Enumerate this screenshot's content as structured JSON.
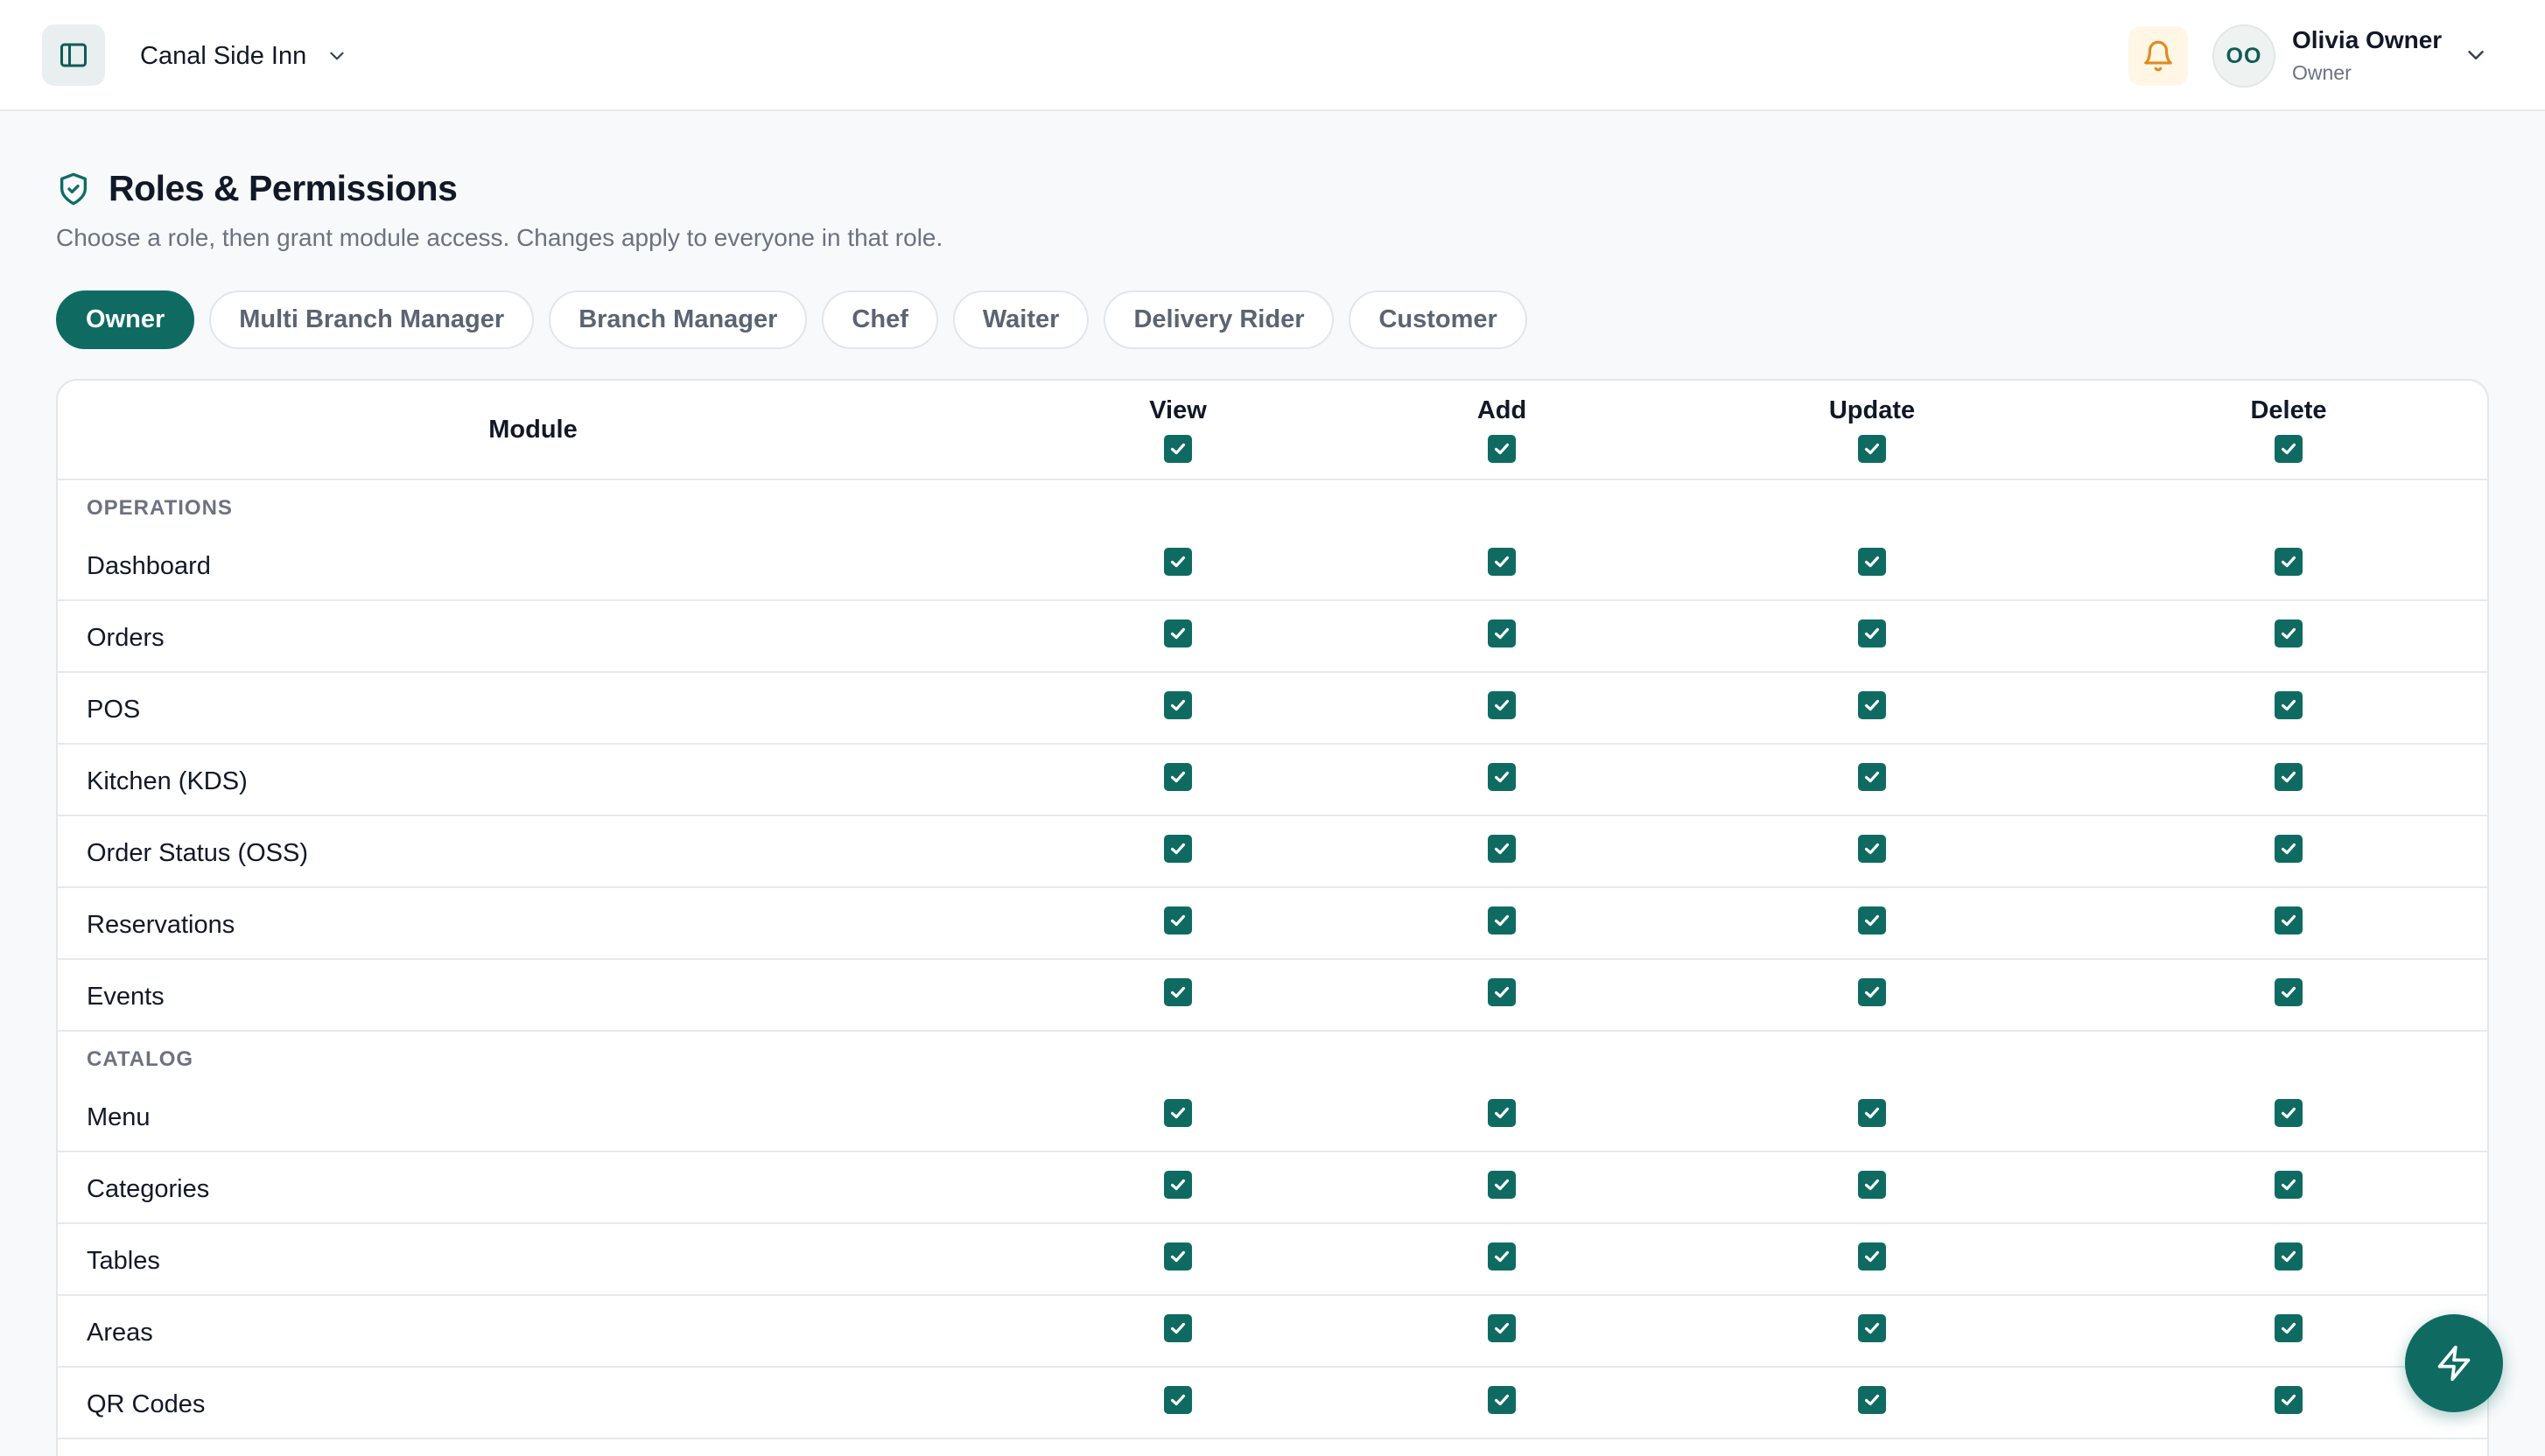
{
  "header": {
    "branch_name": "Canal Side Inn",
    "user_initials": "OO",
    "user_name": "Olivia Owner",
    "user_role": "Owner"
  },
  "page": {
    "title": "Roles & Permissions",
    "subtitle": "Choose a role, then grant module access. Changes apply to everyone in that role."
  },
  "roles": [
    "Owner",
    "Multi Branch Manager",
    "Branch Manager",
    "Chef",
    "Waiter",
    "Delivery Rider",
    "Customer"
  ],
  "active_role": "Owner",
  "table": {
    "columns": {
      "module": "Module",
      "view": "View",
      "add": "Add",
      "update": "Update",
      "delete": "Delete"
    },
    "sections": [
      {
        "label": "OPERATIONS",
        "rows": [
          {
            "module": "Dashboard",
            "view": true,
            "add": true,
            "update": true,
            "delete": true
          },
          {
            "module": "Orders",
            "view": true,
            "add": true,
            "update": true,
            "delete": true
          },
          {
            "module": "POS",
            "view": true,
            "add": true,
            "update": true,
            "delete": true
          },
          {
            "module": "Kitchen (KDS)",
            "view": true,
            "add": true,
            "update": true,
            "delete": true
          },
          {
            "module": "Order Status (OSS)",
            "view": true,
            "add": true,
            "update": true,
            "delete": true
          },
          {
            "module": "Reservations",
            "view": true,
            "add": true,
            "update": true,
            "delete": true
          },
          {
            "module": "Events",
            "view": true,
            "add": true,
            "update": true,
            "delete": true
          }
        ]
      },
      {
        "label": "CATALOG",
        "rows": [
          {
            "module": "Menu",
            "view": true,
            "add": true,
            "update": true,
            "delete": true
          },
          {
            "module": "Categories",
            "view": true,
            "add": true,
            "update": true,
            "delete": true
          },
          {
            "module": "Tables",
            "view": true,
            "add": true,
            "update": true,
            "delete": true
          },
          {
            "module": "Areas",
            "view": true,
            "add": true,
            "update": true,
            "delete": true
          },
          {
            "module": "QR Codes",
            "view": true,
            "add": true,
            "update": true,
            "delete": true
          }
        ]
      }
    ]
  },
  "colors": {
    "accent": "#0f6b62",
    "bell_bg": "#fff6e6",
    "bell_icon": "#e08a1e"
  },
  "icons": {
    "sidebar_toggle": "sidebar-toggle-icon",
    "branch_chevron": "chevron-down-icon",
    "notifications": "bell-icon",
    "title": "shield-check-icon",
    "fab": "lightning-icon"
  }
}
